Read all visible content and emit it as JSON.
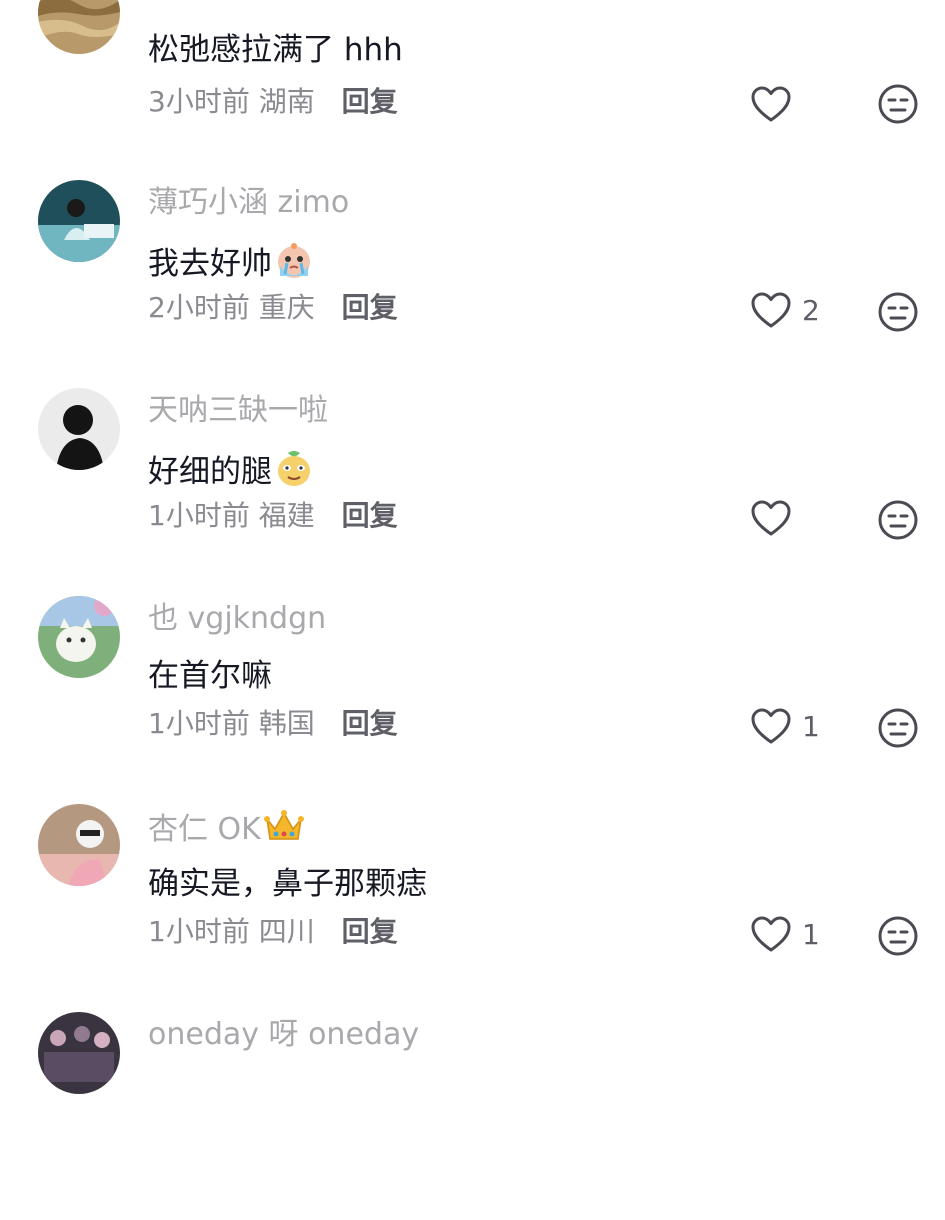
{
  "comments": [
    {
      "username": "",
      "text": "松弛感拉满了 hhh",
      "time": "3小时前",
      "location": "湖南",
      "reply_label": "回复",
      "like_count": "",
      "avatar_color": "#a78a5a"
    },
    {
      "username": "薄巧小涵 zimo",
      "text": "我去好帅",
      "time": "2小时前",
      "location": "重庆",
      "reply_label": "回复",
      "like_count": "2",
      "emoji": "crying-emoji",
      "avatar_color": "#2f6f77"
    },
    {
      "username": "天呐三缺一啦",
      "text": "好细的腿",
      "time": "1小时前",
      "location": "福建",
      "reply_label": "回复",
      "like_count": "",
      "emoji": "smirk-emoji",
      "avatar_color": "#e7e7e7"
    },
    {
      "username": "也 vgjkndgn",
      "text": "在首尔嘛",
      "time": "1小时前",
      "location": "韩国",
      "reply_label": "回复",
      "like_count": "1",
      "avatar_color": "#7fae7a"
    },
    {
      "username": "杏仁 OK",
      "text": "确实是，鼻子那颗痣",
      "time": "1小时前",
      "location": "四川",
      "reply_label": "回复",
      "like_count": "1",
      "badge": "crown-icon",
      "avatar_color": "#c9a58c"
    },
    {
      "username": "oneday 呀 oneday",
      "text": "",
      "time": "",
      "location": "",
      "reply_label": "",
      "like_count": "",
      "avatar_color": "#3a3440"
    }
  ],
  "colors": {
    "username": "#a9a9ad",
    "text": "#161823",
    "meta": "#8a8b91",
    "icon": "#4a4b52"
  }
}
